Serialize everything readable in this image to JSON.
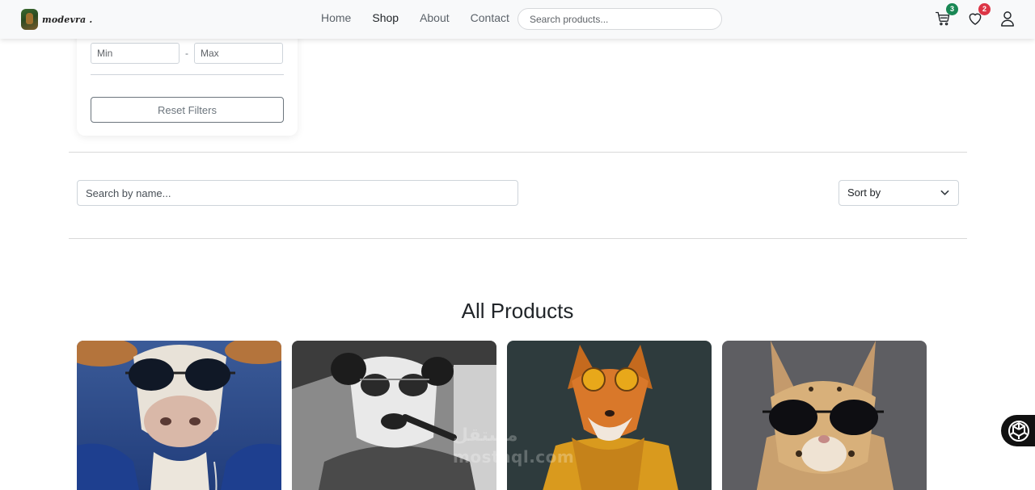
{
  "nav": {
    "brand": "modevra .",
    "links": [
      "Home",
      "Shop",
      "About",
      "Contact"
    ],
    "active_link": "Shop",
    "search_placeholder": "Search products...",
    "cart_count": "3",
    "wishlist_count": "2",
    "icons": [
      "cart-icon",
      "heart-icon",
      "user-icon"
    ]
  },
  "filters": {
    "min_placeholder": "Min",
    "max_placeholder": "Max",
    "separator": "-",
    "reset_label": "Reset Filters"
  },
  "toolbar": {
    "search_placeholder": "Search by name...",
    "sort_label": "Sort by"
  },
  "section": {
    "title": "All Products"
  },
  "products": [
    {
      "image": "cow in sunglasses and blue hoodie"
    },
    {
      "image": "panda in sunglasses smoking"
    },
    {
      "image": "fox in orange sunglasses and yellow coat"
    },
    {
      "image": "serval cat in black sunglasses"
    }
  ],
  "watermark": {
    "arabic": "مستقل",
    "latin": "mostaql.com"
  },
  "colors": {
    "cart_badge": "#198754",
    "wishlist_badge": "#dc3545",
    "navbar_bg": "#f8f9fa"
  }
}
